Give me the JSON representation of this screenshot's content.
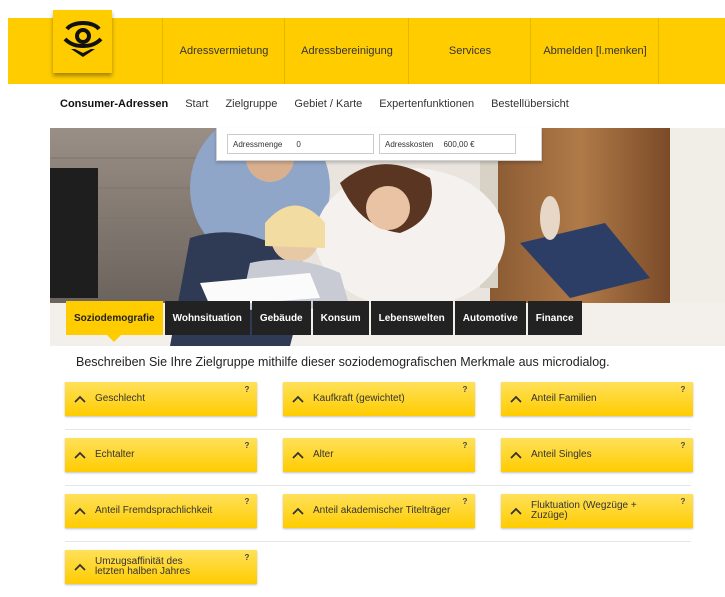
{
  "colors": {
    "brand_yellow": "#ffcc00",
    "tab_dark": "#222222"
  },
  "header": {
    "logo_icon": "posthorn-icon",
    "nav": [
      "Adressvermietung",
      "Adressbereinigung",
      "Services",
      "Abmelden [l.menken]"
    ]
  },
  "subnav": {
    "items": [
      "Consumer-Adressen",
      "Start",
      "Zielgruppe",
      "Gebiet / Karte",
      "Expertenfunktionen",
      "Bestellübersicht"
    ]
  },
  "counters": {
    "menge_label": "Adressmenge",
    "menge_value": "0",
    "kosten_label": "Adresskosten",
    "kosten_value": "600,00 €"
  },
  "tabs": [
    "Soziodemografie",
    "Wohnsituation",
    "Gebäude",
    "Konsum",
    "Lebenswelten",
    "Automotive",
    "Finance"
  ],
  "intro": "Beschreiben Sie Ihre Zielgruppe mithilfe dieser soziodemografischen Merkmale aus microdialog.",
  "criteria": [
    {
      "label": "Geschlecht",
      "help": "?"
    },
    {
      "label": "Kaufkraft (gewichtet)",
      "help": "?"
    },
    {
      "label": "Anteil Familien",
      "help": "?"
    },
    {
      "label": "Echtalter",
      "help": "?"
    },
    {
      "label": "Alter",
      "help": "?"
    },
    {
      "label": "Anteil Singles",
      "help": "?"
    },
    {
      "label": "Anteil Fremdsprachlichkeit",
      "help": "?"
    },
    {
      "label": "Anteil akademischer Titelträger",
      "help": "?"
    },
    {
      "label": "Fluktuation (Wegzüge + Zuzüge)",
      "help": "?"
    },
    {
      "label": "Umzugsaffinität des letzten halben Jahres",
      "help": "?"
    }
  ]
}
